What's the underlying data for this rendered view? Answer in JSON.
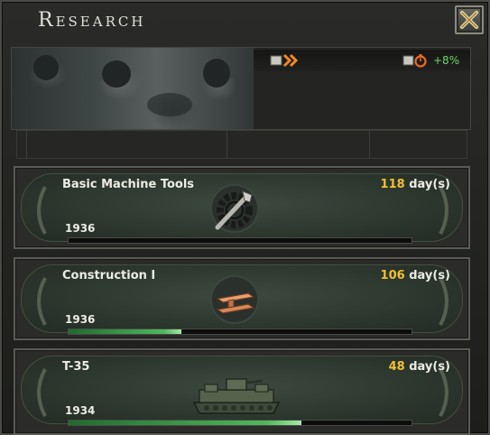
{
  "window": {
    "title": "Research",
    "close_icon": "close-x-icon"
  },
  "status": {
    "left_indicator_icon": "research-speed-arrows-icon",
    "right_indicator_icon": "research-bonus-timer-icon",
    "bonus_text": "+8%",
    "bonus_color": "#6fd46a"
  },
  "slots": [
    {
      "name": "Basic Machine Tools",
      "days_value": "118",
      "days_unit": "day(s)",
      "year": "1936",
      "progress": 0,
      "icon": "machine-tools-wrench-gear-icon"
    },
    {
      "name": "Construction I",
      "days_value": "106",
      "days_unit": "day(s)",
      "year": "1936",
      "progress": 0.33,
      "icon": "construction-girder-icon"
    },
    {
      "name": "T-35",
      "days_value": "48",
      "days_unit": "day(s)",
      "year": "1934",
      "progress": 0.68,
      "icon": "t35-tank-icon"
    }
  ],
  "colors": {
    "days_number": "#f0c030",
    "progress_fill": "#4fb85c"
  }
}
